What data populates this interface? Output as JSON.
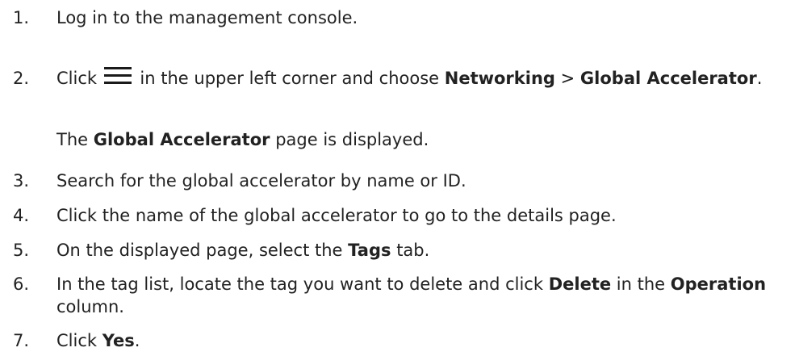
{
  "steps": [
    {
      "number": "1.",
      "text": "Log in to the management console."
    },
    {
      "number": "2.",
      "before_icon": "Click",
      "icon": "menu-icon",
      "after_icon": "in the upper left corner and choose",
      "bold1": "Networking",
      "sep": ">",
      "bold2": "Global Accelerator",
      "end": "."
    },
    {
      "number": "3.",
      "text": "Search for the global accelerator by name or ID."
    },
    {
      "number": "4.",
      "text": "Click the name of the global accelerator to go to the details page."
    },
    {
      "number": "5.",
      "pre": "On the displayed page, select the",
      "bold": "Tags",
      "post": "tab."
    },
    {
      "number": "6.",
      "pre": "In the tag list, locate the tag you want to delete and click",
      "bold1": "Delete",
      "mid": "in the",
      "bold2": "Operation",
      "post": "column."
    },
    {
      "number": "7.",
      "pre": "Click",
      "bold": "Yes",
      "post": "."
    }
  ],
  "step2_note": {
    "pre": "The",
    "bold": "Global Accelerator",
    "post": "page is displayed."
  }
}
